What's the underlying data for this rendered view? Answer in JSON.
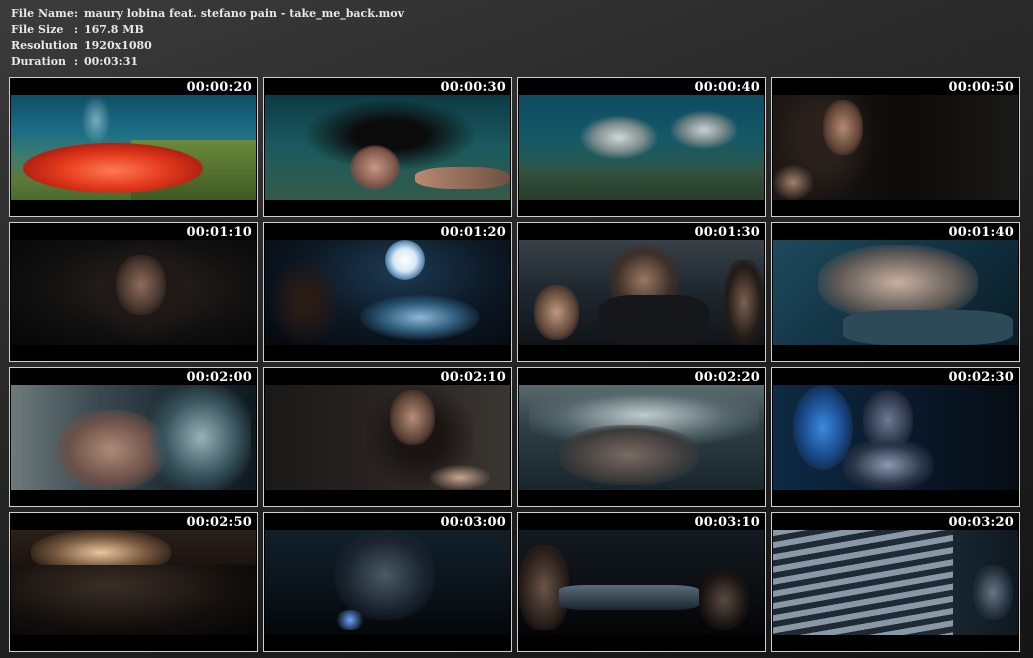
{
  "info": {
    "rows": [
      {
        "key": "File Name",
        "sep": ":",
        "value": "maury lobina feat. stefano pain - take_me_back.mov"
      },
      {
        "key": "File Size",
        "sep": ":",
        "value": "167.8 MB"
      },
      {
        "key": "Resolution",
        "sep": ":",
        "value": "1920x1080"
      },
      {
        "key": "Duration",
        "sep": ":",
        "value": "00:03:31"
      }
    ]
  },
  "thumbnails": [
    {
      "time": "00:00:20"
    },
    {
      "time": "00:00:30"
    },
    {
      "time": "00:00:40"
    },
    {
      "time": "00:00:50"
    },
    {
      "time": "00:01:10"
    },
    {
      "time": "00:01:20"
    },
    {
      "time": "00:01:30"
    },
    {
      "time": "00:01:40"
    },
    {
      "time": "00:02:00"
    },
    {
      "time": "00:02:10"
    },
    {
      "time": "00:02:20"
    },
    {
      "time": "00:02:30"
    },
    {
      "time": "00:02:50"
    },
    {
      "time": "00:03:00"
    },
    {
      "time": "00:03:10"
    },
    {
      "time": "00:03:20"
    }
  ]
}
